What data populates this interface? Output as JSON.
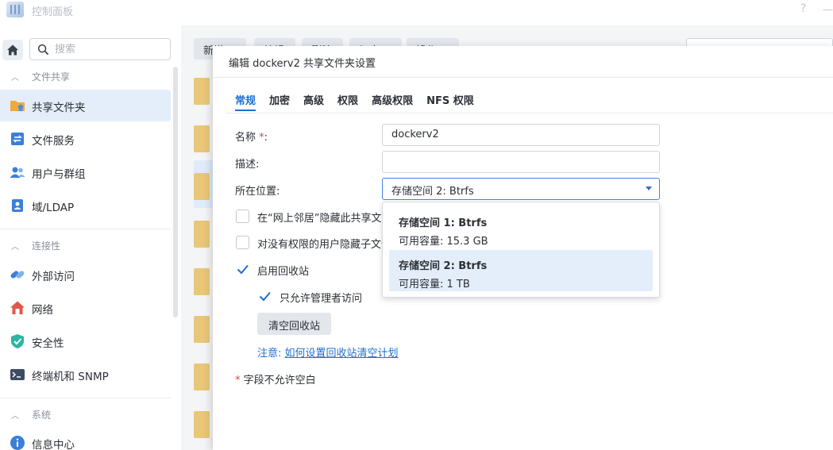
{
  "window": {
    "title": "控制面板",
    "help_glyph": "?",
    "min_glyph": "—"
  },
  "sidebar": {
    "search_placeholder": "搜索",
    "sections": [
      {
        "label": "文件共享",
        "items": [
          {
            "label": "共享文件夹",
            "icon": "shared-folder-icon",
            "active": true
          },
          {
            "label": "文件服务",
            "icon": "file-services-icon"
          },
          {
            "label": "用户与群组",
            "icon": "users-groups-icon"
          },
          {
            "label": "域/LDAP",
            "icon": "domain-ldap-icon"
          }
        ]
      },
      {
        "label": "连接性",
        "items": [
          {
            "label": "外部访问",
            "icon": "external-access-icon"
          },
          {
            "label": "网络",
            "icon": "network-icon"
          },
          {
            "label": "安全性",
            "icon": "security-shield-icon"
          },
          {
            "label": "终端机和 SNMP",
            "icon": "terminal-icon"
          }
        ]
      },
      {
        "label": "系统",
        "items": [
          {
            "label": "信息中心",
            "icon": "info-center-icon"
          }
        ]
      }
    ]
  },
  "toolbar": {
    "buttons": [
      "新增",
      "编辑",
      "删除",
      "加密",
      "操作"
    ]
  },
  "dialog": {
    "title": "编辑 dockerv2 共享文件夹设置",
    "tabs": [
      "常规",
      "加密",
      "高级",
      "权限",
      "高级权限",
      "NFS 权限"
    ],
    "active_tab": "常规",
    "fields": {
      "name_label": "名称",
      "name_required": "*",
      "name_colon": ":",
      "name_value": "dockerv2",
      "desc_label": "描述:",
      "desc_value": "",
      "location_label": "所在位置:",
      "location_value": "存储空间 2:  Btrfs"
    },
    "options": {
      "hide_network": {
        "label": "在“网上邻居”隐藏此共享文件夹",
        "checked": false
      },
      "hide_subfolders": {
        "label": "对没有权限的用户隐藏子文件夹和文件",
        "checked": false
      },
      "enable_recycle": {
        "label": "启用回收站",
        "checked": true
      },
      "admin_only": {
        "label": "只允许管理者访问",
        "checked": true
      }
    },
    "empty_recycle_button": "清空回收站",
    "note_prefix": "注意:",
    "note_link": "如何设置回收站清空计划",
    "footnote_star": "*",
    "footnote_text": " 字段不允许空白",
    "dropdown": [
      {
        "name": "存储空间 1:  Btrfs",
        "capacity": "可用容量:  15.3 GB",
        "selected": false
      },
      {
        "name": "存储空间 2:  Btrfs",
        "capacity": "可用容量:  1 TB",
        "selected": true
      }
    ]
  }
}
